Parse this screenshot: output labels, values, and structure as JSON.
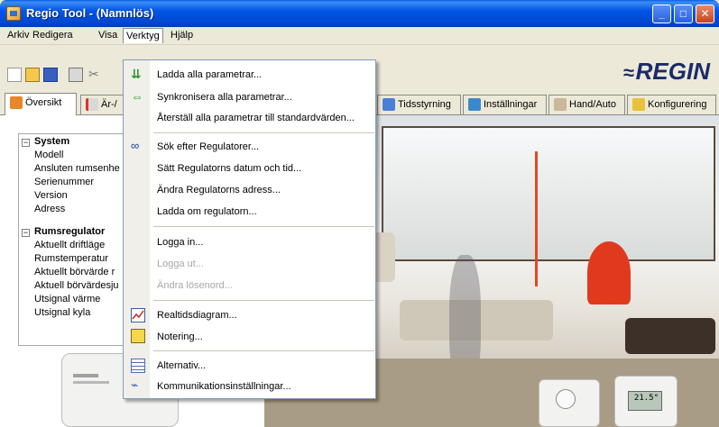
{
  "window": {
    "title": "Regio Tool - (Namnlös)"
  },
  "menubar": {
    "items": [
      "Arkiv",
      "Redigera",
      "Visa",
      "Verktyg",
      "Hjälp"
    ]
  },
  "brand": {
    "logo_text": "REGIN",
    "color": "#1a2a6a"
  },
  "tabs": [
    {
      "label": "Översikt",
      "selected": true
    },
    {
      "label": "Är-/"
    },
    {
      "label": "Tidsstyrning"
    },
    {
      "label": "Inställningar"
    },
    {
      "label": "Hand/Auto"
    },
    {
      "label": "Konfigurering"
    }
  ],
  "tree": {
    "groups": [
      {
        "label": "System",
        "items": [
          "Modell",
          "Ansluten rumsenhe",
          "Serienummer",
          "Version",
          "Adress"
        ]
      },
      {
        "label": "Rumsregulator",
        "items": [
          "Aktuellt driftläge",
          "Rumstemperatur",
          "Aktuellt börvärde r",
          "Aktuell börvärdesju",
          "Utsignal värme",
          "Utsignal kyla"
        ]
      }
    ]
  },
  "device": {
    "lcd_text": "21.5°"
  },
  "verktyg_menu": {
    "items": [
      {
        "label": "Ladda alla parametrar...",
        "icon": "download-params-icon"
      },
      {
        "label": "Synkronisera alla parametrar...",
        "icon": "sync-arrows-icon"
      },
      {
        "label": "Återställ alla parametrar till standardvärden...",
        "icon": ""
      },
      {
        "label": "Sök efter Regulatorer...",
        "icon": "binoculars-icon"
      },
      {
        "label": "Sätt Regulatorns datum och tid...",
        "icon": ""
      },
      {
        "label": "Ändra Regulatorns adress...",
        "icon": ""
      },
      {
        "label": "Ladda om regulatorn...",
        "icon": ""
      },
      {
        "label": "Logga in...",
        "icon": ""
      },
      {
        "label": "Logga ut...",
        "icon": "",
        "disabled": true
      },
      {
        "label": "Ändra lösenord...",
        "icon": "",
        "disabled": true
      },
      {
        "label": "Realtidsdiagram...",
        "icon": "chart-icon"
      },
      {
        "label": "Notering...",
        "icon": "note-pencil-icon"
      },
      {
        "label": "Alternativ...",
        "icon": "options-list-icon"
      },
      {
        "label": "Kommunikationsinställningar...",
        "icon": "connection-icon"
      }
    ]
  }
}
